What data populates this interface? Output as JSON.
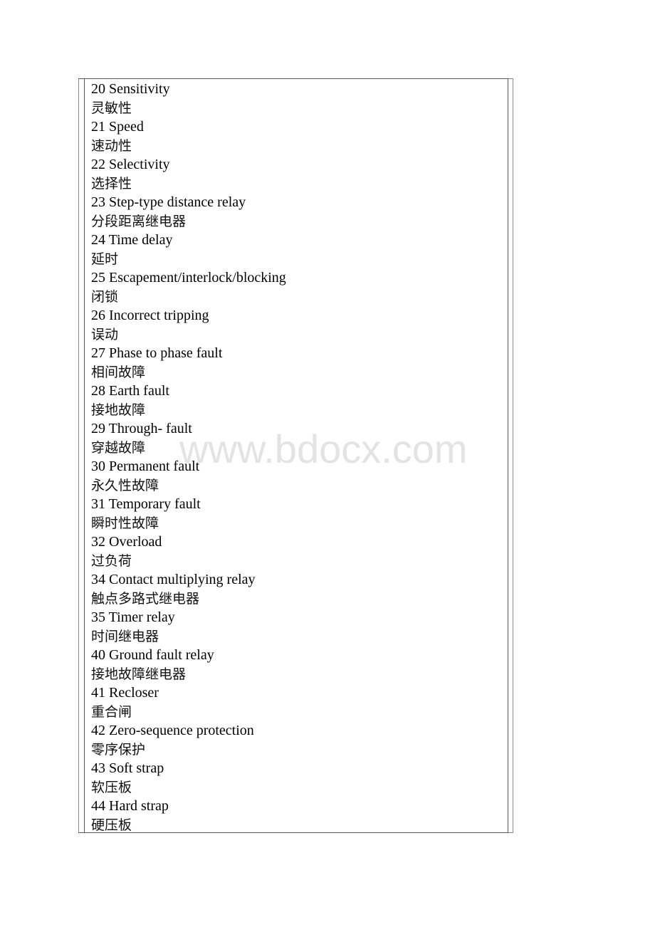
{
  "watermark": "www.bdocx.com",
  "entries": [
    {
      "en": "20 Sensitivity",
      "zh": "灵敏性"
    },
    {
      "en": "21 Speed",
      "zh": "速动性"
    },
    {
      "en": "22 Selectivity",
      "zh": "选择性"
    },
    {
      "en": "23 Step-type distance relay",
      "zh": "分段距离继电器"
    },
    {
      "en": "24 Time delay",
      "zh": "延时"
    },
    {
      "en": "25 Escapement/interlock/blocking",
      "zh": "闭锁"
    },
    {
      "en": "26 Incorrect tripping",
      "zh": "误动"
    },
    {
      "en": "27 Phase to phase fault",
      "zh": "相间故障"
    },
    {
      "en": "28 Earth fault",
      "zh": "接地故障"
    },
    {
      "en": "29 Through- fault",
      "zh": "穿越故障"
    },
    {
      "en": "30 Permanent fault",
      "zh": "永久性故障"
    },
    {
      "en": "31 Temporary fault",
      "zh": "瞬时性故障"
    },
    {
      "en": "32 Overload",
      "zh": "过负荷"
    },
    {
      "en": "34 Contact multiplying relay",
      "zh": "触点多路式继电器"
    },
    {
      "en": "35 Timer relay",
      "zh": "时间继电器"
    },
    {
      "en": "40 Ground fault relay",
      "zh": "接地故障继电器"
    },
    {
      "en": "41 Recloser",
      "zh": "重合闸"
    },
    {
      "en": "42 Zero-sequence protection",
      "zh": "零序保护"
    },
    {
      "en": "43 Soft strap",
      "zh": "软压板"
    },
    {
      "en": "44 Hard strap",
      "zh": "硬压板"
    }
  ]
}
